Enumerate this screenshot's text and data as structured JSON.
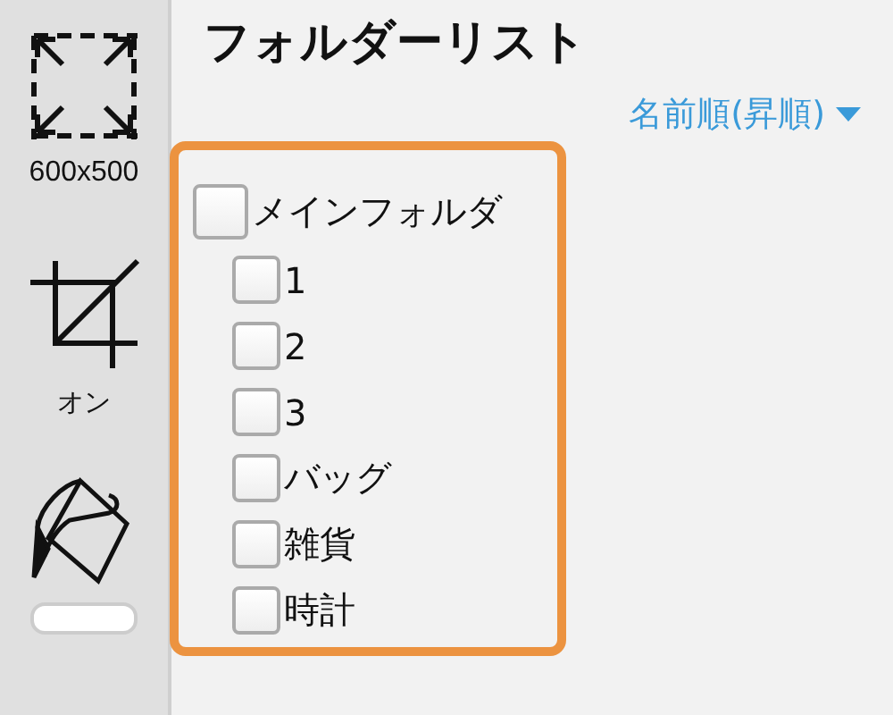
{
  "sidebar": {
    "items": [
      {
        "kind": "resize",
        "label": "600x500"
      },
      {
        "kind": "crop",
        "label": "オン"
      },
      {
        "kind": "fill"
      }
    ]
  },
  "title": "フォルダーリスト",
  "sort": {
    "label": "名前順(昇順)"
  },
  "folders": [
    {
      "label": "メインフォルダ",
      "checked": false,
      "children": [
        {
          "label": "1",
          "checked": false
        },
        {
          "label": "2",
          "checked": false
        },
        {
          "label": "3",
          "checked": false
        },
        {
          "label": "バッグ",
          "checked": false
        },
        {
          "label": "雑貨",
          "checked": false
        },
        {
          "label": "時計",
          "checked": false
        }
      ]
    }
  ]
}
